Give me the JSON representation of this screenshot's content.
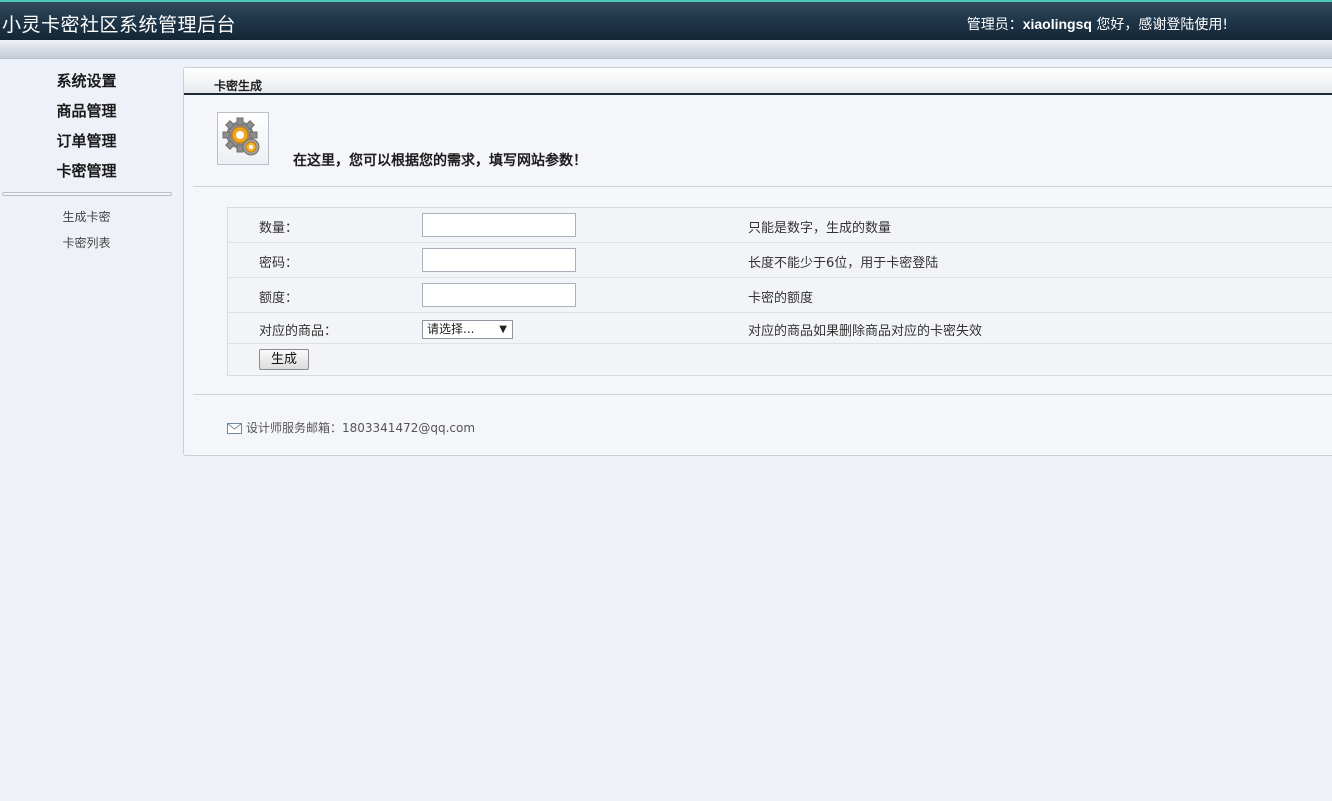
{
  "header": {
    "title": "小灵卡密社区系统管理后台",
    "admin_prefix": "管理员：",
    "admin_name": "xiaolingsq",
    "admin_suffix": " 您好，感谢登陆使用!"
  },
  "sidebar": {
    "main_items": [
      {
        "label": "系统设置"
      },
      {
        "label": "商品管理"
      },
      {
        "label": "订单管理"
      },
      {
        "label": "卡密管理"
      }
    ],
    "sub_items": [
      {
        "label": "生成卡密"
      },
      {
        "label": "卡密列表"
      }
    ]
  },
  "panel": {
    "title": "卡密生成",
    "intro_icon": "gear-icon",
    "intro": "在这里，您可以根据您的需求，填写网站参数！",
    "form": {
      "rows": [
        {
          "label": "数量：",
          "value": "",
          "hint": "只能是数字，生成的数量"
        },
        {
          "label": "密码：",
          "value": "",
          "hint": "长度不能少于6位，用于卡密登陆"
        },
        {
          "label": "额度：",
          "value": "",
          "hint": "卡密的额度"
        }
      ],
      "product": {
        "label": "对应的商品：",
        "selected": "请选择...",
        "hint": "对应的商品如果删除商品对应的卡密失效"
      },
      "submit_label": "生成"
    },
    "footer": "设计师服务邮箱：1803341472@qq.com"
  },
  "colors": {
    "header_top": "#33495c",
    "header_bottom": "#142636",
    "header_accent": "#49c9b5",
    "background": "#eef2f8",
    "panel_rule": "#1d2a36"
  }
}
